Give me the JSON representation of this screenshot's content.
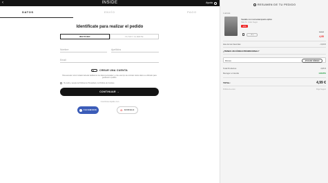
{
  "topbar": {
    "back": "‹",
    "logo": "INSIDE",
    "help": "Ayuda"
  },
  "steps": [
    "DATOS",
    "ENVÍO",
    "PAGO"
  ],
  "form": {
    "title": "Identifícate para realizar el pedido",
    "tab_guest": "INVITADO",
    "tab_member": "YA SOY CLIENTE",
    "name_placeholder": "Nombre",
    "surname_placeholder": "Apellidos",
    "email_placeholder": "Email",
    "create_account": "CREAR UNA CUENTA",
    "legal_text": "Para acceder como invitado deberás facilitarnos tus datos personales y el de este tipo de contrato. Estos datos se utilizarán para gestionar tu pedido.",
    "checkbox_text": "He leído y acepto la Política de Privacidad y la Política de Cookies",
    "continue": "CONTINUAR  →",
    "or_text": "Continúa rápido con",
    "facebook": "FACEBOOK",
    "google": "GOOGLE"
  },
  "summary": {
    "header": "RESUMEN DE TU PEDIDO",
    "count": "1 artículo",
    "product_name": "Vestido con red estampado épilco",
    "product_meta": "Talla: M · Color: Negro",
    "discount_badge": "-20%",
    "qty": "- 1 +",
    "old_price": "6,19 €",
    "new_price": "4,95",
    "subtotal_label": "Has de las Favoritas",
    "subtotal_value": "- 0,00 €",
    "promo_label": "¿TIENES UN CÓDIGO PROMOCIONAL?",
    "coupon_label": "BIGGA",
    "apply": "APLICAR CÓDIGO",
    "products_label": "Total Productos",
    "products_value": "4,95 €",
    "shipping_label": "Recoger en tienda",
    "shipping_value": "GRATIS",
    "total_label": "TOTAL:",
    "total_value": "4,99 €",
    "foot_left": "Política de envío",
    "foot_right": "Pago Seguro"
  },
  "colors": {
    "dark": "#141414",
    "facebook": "#3b5cb8",
    "sale": "#e22222",
    "free": "#1a9a3a"
  }
}
